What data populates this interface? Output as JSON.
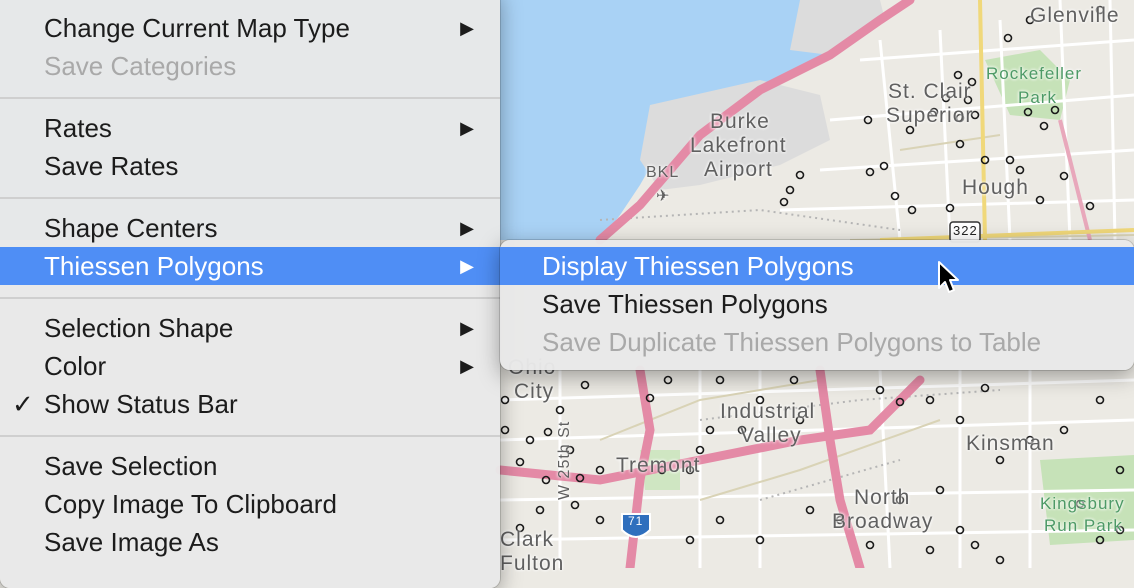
{
  "menu": {
    "groups": [
      [
        {
          "label": "Change Current Map Type",
          "submenu": true,
          "enabled": true
        },
        {
          "label": "Save Categories",
          "submenu": false,
          "enabled": false
        }
      ],
      [
        {
          "label": "Rates",
          "submenu": true,
          "enabled": true
        },
        {
          "label": "Save Rates",
          "submenu": false,
          "enabled": true
        }
      ],
      [
        {
          "label": "Shape Centers",
          "submenu": true,
          "enabled": true
        },
        {
          "label": "Thiessen Polygons",
          "submenu": true,
          "enabled": true,
          "highlighted": true
        }
      ],
      [
        {
          "label": "Selection Shape",
          "submenu": true,
          "enabled": true
        },
        {
          "label": "Color",
          "submenu": true,
          "enabled": true
        },
        {
          "label": "Show Status Bar",
          "submenu": false,
          "enabled": true,
          "checked": true
        }
      ],
      [
        {
          "label": "Save Selection",
          "submenu": false,
          "enabled": true
        },
        {
          "label": "Copy Image To Clipboard",
          "submenu": false,
          "enabled": true
        },
        {
          "label": "Save Image As",
          "submenu": false,
          "enabled": true
        }
      ]
    ]
  },
  "submenu": {
    "items": [
      {
        "label": "Display Thiessen Polygons",
        "enabled": true,
        "highlighted": true
      },
      {
        "label": "Save Thiessen Polygons",
        "enabled": true
      },
      {
        "label": "Save Duplicate Thiessen Polygons to Table",
        "enabled": false
      }
    ]
  },
  "map": {
    "labels": {
      "glenville": "Glenville",
      "rockefeller": "Rockefeller",
      "park": "Park",
      "st_clair": "St. Clair",
      "superior": "Superior",
      "burke": "Burke",
      "lakefront": "Lakefront",
      "airport": "Airport",
      "bkl": "BKL",
      "hough": "Hough",
      "us322": "322",
      "ohio": "Ohio",
      "city": "City",
      "industrial": "Industrial",
      "valley": "Valley",
      "kinsman": "Kinsman",
      "tremont": "Tremont",
      "w25th": "W 25th St",
      "i71": "71",
      "north": "North",
      "broadway": "Broadway",
      "kingsbury": "Kingsbury",
      "run_park": "Run Park",
      "clark": "Clark",
      "fulton": "Fulton"
    },
    "colors": {
      "water": "#a9d2f5",
      "land": "#eceae4",
      "highway": "#e48aa6",
      "park": "#c6e2b8",
      "interstate": "#2f6fbd"
    }
  },
  "icons": {
    "submenu_arrow": "triangle-right-icon",
    "check": "checkmark-icon",
    "cursor": "arrow-pointer-icon",
    "airport": "airplane-icon"
  }
}
